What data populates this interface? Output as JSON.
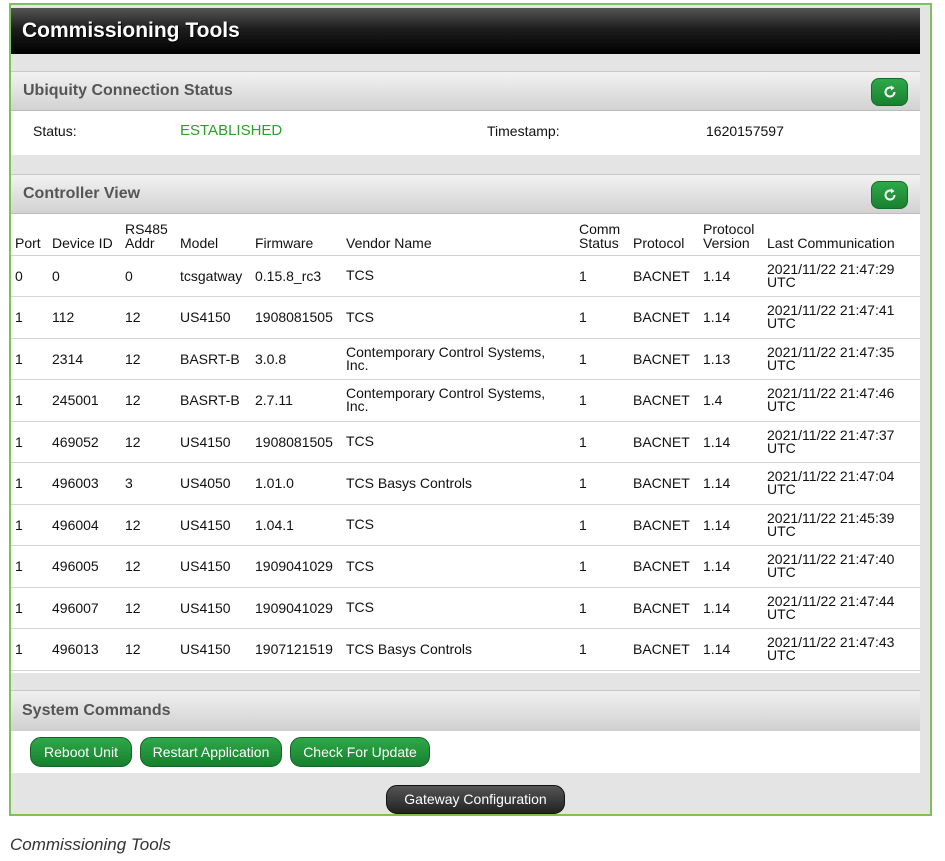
{
  "title": "Commissioning Tools",
  "ubiquity": {
    "heading": "Ubiquity Connection Status",
    "status_label": "Status:",
    "status_value": "ESTABLISHED",
    "timestamp_label": "Timestamp:",
    "timestamp_value": "1620157597"
  },
  "controller": {
    "heading": "Controller View",
    "columns": [
      "Port",
      "Device ID",
      "RS485 Addr",
      "Model",
      "Firmware",
      "Vendor Name",
      "Comm Status",
      "Protocol",
      "Protocol Version",
      "Last Communication"
    ],
    "rows": [
      [
        "0",
        "0",
        "0",
        "tcsgatway",
        "0.15.8_rc3",
        "TCS",
        "1",
        "BACNET",
        "1.14",
        "2021/11/22 21:47:29 UTC"
      ],
      [
        "1",
        "112",
        "12",
        "US4150",
        "1908081505",
        "TCS",
        "1",
        "BACNET",
        "1.14",
        "2021/11/22 21:47:41 UTC"
      ],
      [
        "1",
        "2314",
        "12",
        "BASRT-B",
        "3.0.8",
        "Contemporary Control Systems, Inc.",
        "1",
        "BACNET",
        "1.13",
        "2021/11/22 21:47:35 UTC"
      ],
      [
        "1",
        "245001",
        "12",
        "BASRT-B",
        "2.7.11",
        "Contemporary Control Systems, Inc.",
        "1",
        "BACNET",
        "1.4",
        "2021/11/22 21:47:46 UTC"
      ],
      [
        "1",
        "469052",
        "12",
        "US4150",
        "1908081505",
        "TCS",
        "1",
        "BACNET",
        "1.14",
        "2021/11/22 21:47:37 UTC"
      ],
      [
        "1",
        "496003",
        "3",
        "US4050",
        "1.01.0",
        "TCS Basys Controls",
        "1",
        "BACNET",
        "1.14",
        "2021/11/22 21:47:04 UTC"
      ],
      [
        "1",
        "496004",
        "12",
        "US4150",
        "1.04.1",
        "TCS",
        "1",
        "BACNET",
        "1.14",
        "2021/11/22 21:45:39 UTC"
      ],
      [
        "1",
        "496005",
        "12",
        "US4150",
        "1909041029",
        "TCS",
        "1",
        "BACNET",
        "1.14",
        "2021/11/22 21:47:40 UTC"
      ],
      [
        "1",
        "496007",
        "12",
        "US4150",
        "1909041029",
        "TCS",
        "1",
        "BACNET",
        "1.14",
        "2021/11/22 21:47:44 UTC"
      ],
      [
        "1",
        "496013",
        "12",
        "US4150",
        "1907121519",
        "TCS Basys Controls",
        "1",
        "BACNET",
        "1.14",
        "2021/11/22 21:47:43 UTC"
      ]
    ]
  },
  "system_commands": {
    "heading": "System Commands",
    "buttons": [
      "Reboot Unit",
      "Restart Application",
      "Check For Update"
    ]
  },
  "gateway_button": "Gateway Configuration",
  "caption": "Commissioning Tools",
  "icons": {
    "refresh": "refresh-icon"
  },
  "colors": {
    "accent_green": "#1f9a3a",
    "status_green": "#2aa12a",
    "frame_green": "#7dc15b"
  }
}
